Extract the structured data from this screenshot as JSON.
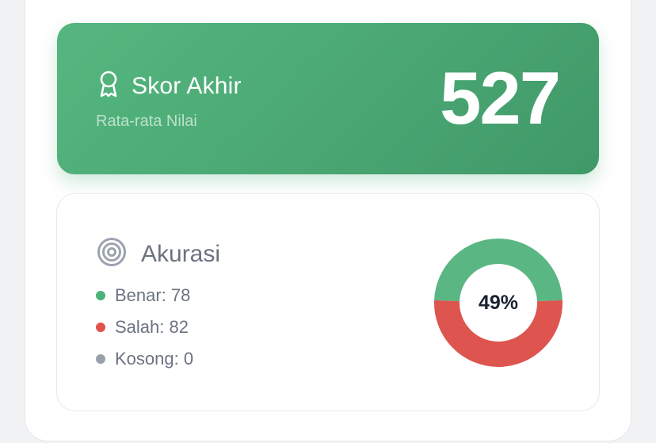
{
  "score": {
    "title": "Skor Akhir",
    "subtitle": "Rata-rata Nilai",
    "value": "527",
    "icon": "award-ribbon-icon"
  },
  "accuracy": {
    "title": "Akurasi",
    "icon": "target-icon",
    "percent_label": "49%",
    "legend": [
      {
        "label": "Benar: 78",
        "color": "#4cb27a"
      },
      {
        "label": "Salah: 82",
        "color": "#e0524b"
      },
      {
        "label": "Kosong: 0",
        "color": "#9aa0aa"
      }
    ],
    "donut": {
      "correct": 78,
      "wrong": 82,
      "empty": 0,
      "colors": {
        "correct": "#5ab783",
        "wrong": "#dd554e",
        "empty": "#d1d5db"
      }
    }
  },
  "colors": {
    "brand_green": "#4aa773",
    "text_gray": "#6b7280",
    "text_dark": "#1b2330"
  }
}
